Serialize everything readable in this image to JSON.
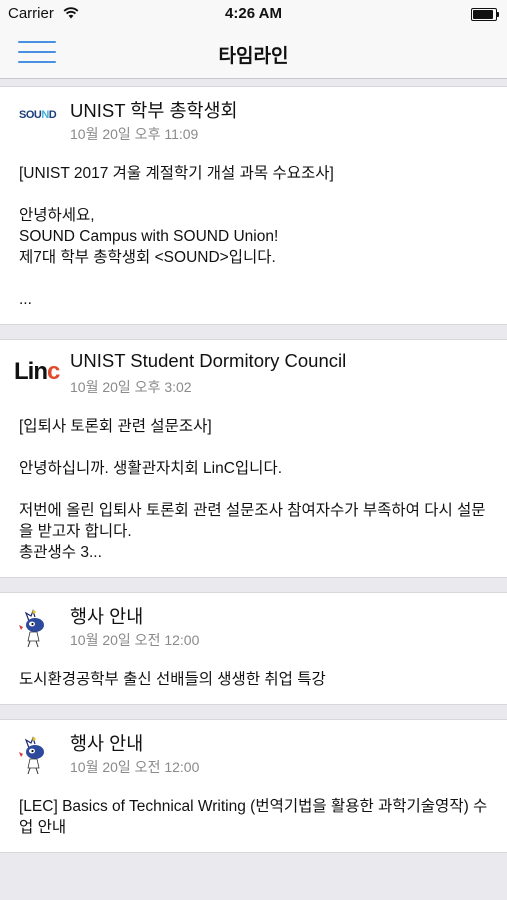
{
  "status": {
    "carrier": "Carrier",
    "time": "4:26 AM"
  },
  "nav": {
    "title": "타임라인"
  },
  "logos": {
    "sound": {
      "a": "SOU",
      "b": "N",
      "c": "D"
    },
    "linc": {
      "a": "Lin",
      "b": "c"
    }
  },
  "posts": [
    {
      "name": "UNIST 학부 총학생회",
      "date": "10월 20일 오후 11:09",
      "body": "[UNIST 2017 겨울 계절학기 개설 과목 수요조사]\n\n안녕하세요,\nSOUND Campus with SOUND Union!\n제7대 학부 총학생회 <SOUND>입니다.\n\n..."
    },
    {
      "name": "UNIST Student Dormitory Council",
      "date": "10월 20일 오후 3:02",
      "body": "[입퇴사 토론회 관련 설문조사]\n\n안녕하십니까. 생활관자치회 LinC입니다.\n\n저번에 올린 입퇴사 토론회 관련 설문조사 참여자수가 부족하여 다시 설문을 받고자 합니다.\n총관생수 3..."
    },
    {
      "name": "행사 안내",
      "date": "10월 20일 오전 12:00",
      "body": "도시환경공학부 출신 선배들의 생생한 취업 특강"
    },
    {
      "name": "행사 안내",
      "date": "10월 20일 오전 12:00",
      "body": "[LEC] Basics of Technical Writing (번역기법을 활용한 과학기술영작) 수업 안내"
    }
  ]
}
